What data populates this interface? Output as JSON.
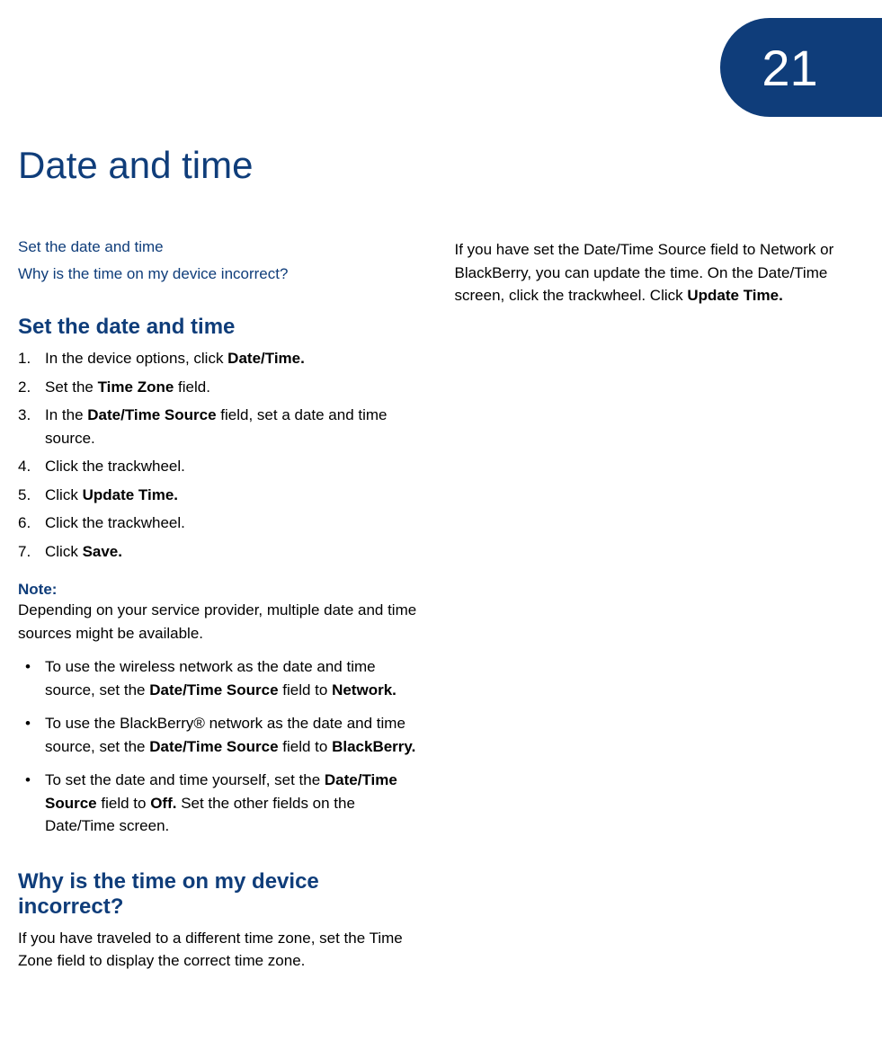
{
  "chapter_number": "21",
  "page_title": "Date and time",
  "toc": {
    "link1": "Set the date and time",
    "link2": "Why is the time on my device incorrect?"
  },
  "section1": {
    "heading": "Set the date and time",
    "steps": {
      "s1_pre": "In the device options, click ",
      "s1_bold": "Date/Time.",
      "s2_pre": "Set the ",
      "s2_bold": "Time Zone",
      "s2_post": " field.",
      "s3_pre": "In the ",
      "s3_bold": "Date/Time Source",
      "s3_post": " field, set a date and time source.",
      "s4": "Click the trackwheel.",
      "s5_pre": "Click ",
      "s5_bold": "Update Time.",
      "s6": "Click the trackwheel.",
      "s7_pre": "Click ",
      "s7_bold": "Save."
    },
    "note_label": "Note:",
    "note_text": "Depending on your service provider, multiple date and time sources might be available.",
    "bullets": {
      "b1_pre": "To use the wireless network as the date and time source, set the ",
      "b1_bold1": "Date/Time Source",
      "b1_mid": " field to ",
      "b1_bold2": "Network.",
      "b2_pre": "To use the BlackBerry® network as the date and time source, set the ",
      "b2_bold1": "Date/Time Source",
      "b2_mid": " field to ",
      "b2_bold2": "BlackBerry.",
      "b3_pre": "To set the date and time yourself, set the ",
      "b3_bold1": "Date/Time Source",
      "b3_mid": " field to ",
      "b3_bold2": "Off.",
      "b3_post": " Set the other fields on the Date/Time screen."
    }
  },
  "section2": {
    "heading": "Why is the time on my device incorrect?",
    "para1": "If you have traveled to a different time zone, set the Time Zone field to display the correct time zone."
  },
  "col2": {
    "para_pre": "If you have set the Date/Time Source field to Network or BlackBerry, you can update the time. On the Date/Time screen, click the trackwheel. Click ",
    "para_bold": "Update Time."
  }
}
